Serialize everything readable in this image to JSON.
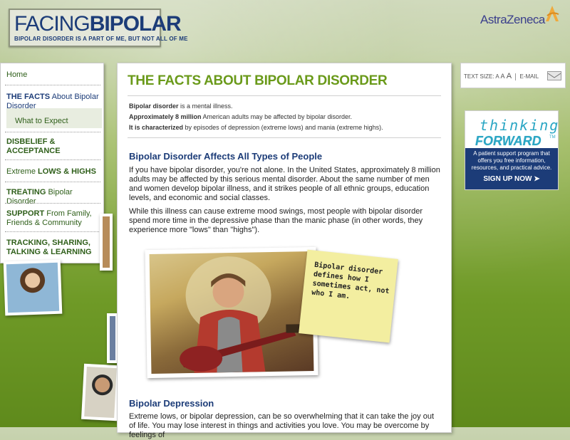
{
  "header": {
    "logo_thin": "FACING",
    "logo_bold": "BIPOLAR",
    "logo_tagline": "BIPOLAR DISORDER IS A PART OF ME, BUT NOT ALL OF ME",
    "brand": "AstraZeneca"
  },
  "nav": {
    "items": [
      {
        "pre": "Home",
        "caps": "",
        "post": ""
      },
      {
        "pre": "",
        "caps": "THE FACTS",
        "post": " About Bipolar Disorder"
      },
      {
        "pre": "What to Expect",
        "caps": "",
        "post": ""
      },
      {
        "pre": "",
        "caps": "DISBELIEF & ACCEPTANCE",
        "post": ""
      },
      {
        "pre": "Extreme ",
        "caps": "LOWS & HIGHS",
        "post": ""
      },
      {
        "pre": "",
        "caps": "TREATING",
        "post": " Bipolar Disorder"
      },
      {
        "pre": "",
        "caps": "SUPPORT",
        "post": " From Family, Friends & Community"
      },
      {
        "pre": "",
        "caps": "TRACKING, SHARING, TALKING & LEARNING",
        "post": ""
      }
    ]
  },
  "main": {
    "title": "THE FACTS ABOUT BIPOLAR DISORDER",
    "facts": [
      {
        "bold": "Bipolar disorder",
        "rest": " is a mental illness."
      },
      {
        "bold": "Approximately 8 million",
        "rest": " American adults may be affected by bipolar disorder."
      },
      {
        "bold": "It is characterized",
        "rest": " by episodes of depression (extreme lows) and mania (extreme highs)."
      }
    ],
    "section1_heading": "Bipolar Disorder Affects All Types of People",
    "section1_p1": "If you have bipolar disorder, you're not alone. In the United States, approximately 8 million adults may be affected by this serious mental disorder. About the same number of men and women develop bipolar illness, and it strikes people of all ethnic groups, education levels, and economic and social classes.",
    "section1_p2": "While this illness can cause extreme mood swings, most people with bipolar disorder spend more time in the depressive phase than the manic phase (in other words, they experience more \"lows\" than \"highs\").",
    "note": "Bipolar disorder defines how I sometimes act, not who I am.",
    "section2_heading": "Bipolar Depression",
    "section2_p1": "Extreme lows, or bipolar depression, can be so overwhelming that it can take the joy out of life. You may lose interest in things and activities you love. You may be overcome by feelings of"
  },
  "utility": {
    "text_size_label": "TEXT SIZE:",
    "size_a1": "A",
    "size_a2": "A",
    "size_a3": "A",
    "email_label": "E-MAIL"
  },
  "promo": {
    "line1": "thinking",
    "line2": "FORWARD",
    "tm": "TM",
    "description": "A patient support program that offers you free information, resources, and practical advice.",
    "cta": "SIGN UP NOW ➤"
  },
  "colors": {
    "accent_green": "#6a9a1a",
    "nav_navy": "#1c3c78",
    "promo_teal": "#2aa6c4"
  }
}
